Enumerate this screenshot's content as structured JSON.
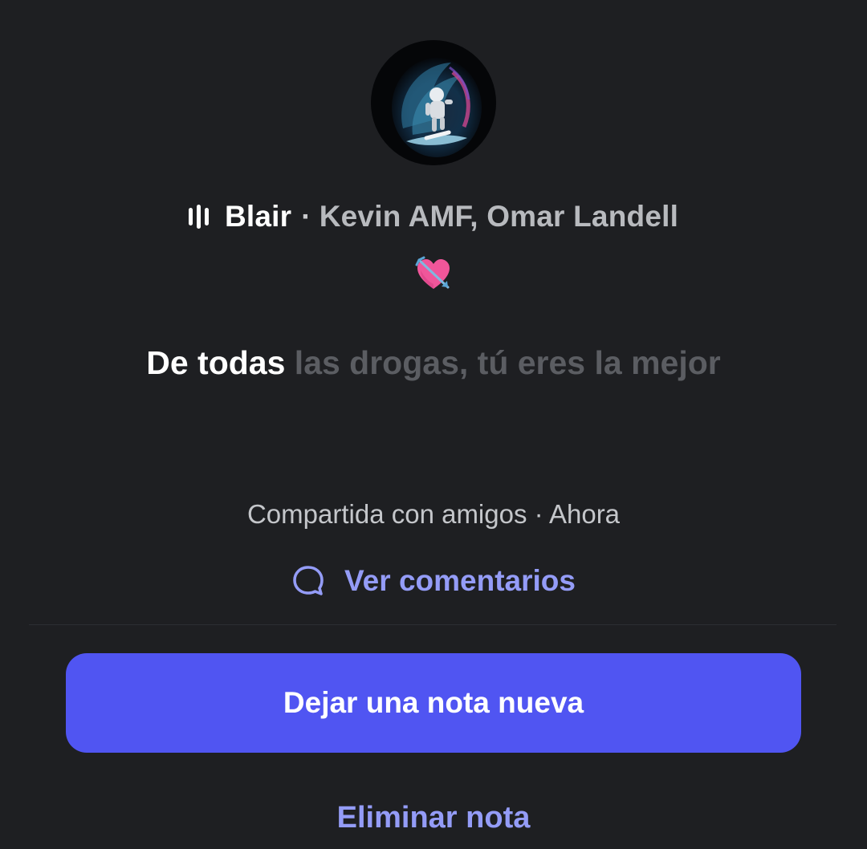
{
  "note": {
    "song": {
      "title": "Blair",
      "separator": "·",
      "artists": "Kevin AMF, Omar Landell"
    },
    "emoji": "💘",
    "lyrics": {
      "active": "De todas",
      "upcoming": "las drogas, tú eres la mejor"
    },
    "meta": "Compartida con amigos · Ahora",
    "comments_label": "Ver comentarios"
  },
  "actions": {
    "new_note_label": "Dejar una nota nueva",
    "delete_label": "Eliminar nota"
  },
  "icons": {
    "equalizer": "audio-bars-icon",
    "comment": "speech-bubble-icon"
  },
  "colors": {
    "background": "#1e1f22",
    "accent": "#5055f2",
    "link": "#949cf7",
    "dim_text": "#5b5d62"
  }
}
